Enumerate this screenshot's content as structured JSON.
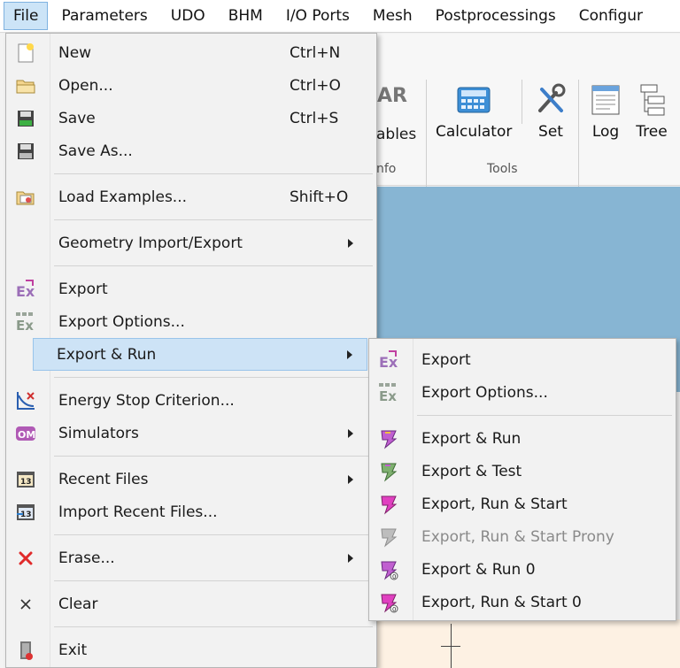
{
  "menubar": {
    "items": [
      "File",
      "Parameters",
      "UDO",
      "BHM",
      "I/O Ports",
      "Mesh",
      "Postprocessings",
      "Configur"
    ]
  },
  "ribbon": {
    "partial_label_top": "AR",
    "variables_label": "ables",
    "info_group": "nfo",
    "calculator_label": "Calculator",
    "set_label": "Set",
    "tools_group": "Tools",
    "log_label": "Log",
    "tree_label": "Tree"
  },
  "file_menu": {
    "items": [
      {
        "label": "New",
        "shortcut": "Ctrl+N",
        "icon": "new-file-icon"
      },
      {
        "label": "Open...",
        "shortcut": "Ctrl+O",
        "icon": "open-folder-icon"
      },
      {
        "label": "Save",
        "shortcut": "Ctrl+S",
        "icon": "save-icon"
      },
      {
        "label": "Save As...",
        "shortcut": "",
        "icon": "save-as-icon"
      },
      {
        "label": "Load Examples...",
        "shortcut": "Shift+O",
        "icon": "load-examples-icon"
      },
      {
        "label": "Geometry Import/Export",
        "shortcut": "",
        "icon": ""
      },
      {
        "label": "Export",
        "shortcut": "",
        "icon": "export-icon"
      },
      {
        "label": "Export Options...",
        "shortcut": "",
        "icon": "export-options-icon"
      },
      {
        "label": "Export & Run",
        "shortcut": "",
        "icon": ""
      },
      {
        "label": "Energy Stop Criterion...",
        "shortcut": "",
        "icon": "energy-stop-icon"
      },
      {
        "label": "Simulators",
        "shortcut": "",
        "icon": "simulators-icon"
      },
      {
        "label": "Recent Files",
        "shortcut": "",
        "icon": "recent-files-icon"
      },
      {
        "label": "Import Recent Files...",
        "shortcut": "",
        "icon": "import-recent-icon"
      },
      {
        "label": "Erase...",
        "shortcut": "",
        "icon": "erase-icon"
      },
      {
        "label": "Clear",
        "shortcut": "",
        "icon": "clear-icon"
      },
      {
        "label": "Exit",
        "shortcut": "",
        "icon": "exit-icon"
      }
    ]
  },
  "submenu": {
    "items": [
      {
        "label": "Export",
        "icon": "export-icon"
      },
      {
        "label": "Export Options...",
        "icon": "export-options-icon"
      },
      {
        "label": "Export & Run",
        "icon": "export-run-icon"
      },
      {
        "label": "Export & Test",
        "icon": "export-test-icon"
      },
      {
        "label": "Export, Run & Start",
        "icon": "export-run-start-icon"
      },
      {
        "label": "Export, Run & Start Prony",
        "icon": "export-run-start-prony-icon"
      },
      {
        "label": "Export & Run 0",
        "icon": "export-run-0-icon"
      },
      {
        "label": "Export, Run & Start 0",
        "icon": "export-run-start-0-icon"
      }
    ]
  }
}
